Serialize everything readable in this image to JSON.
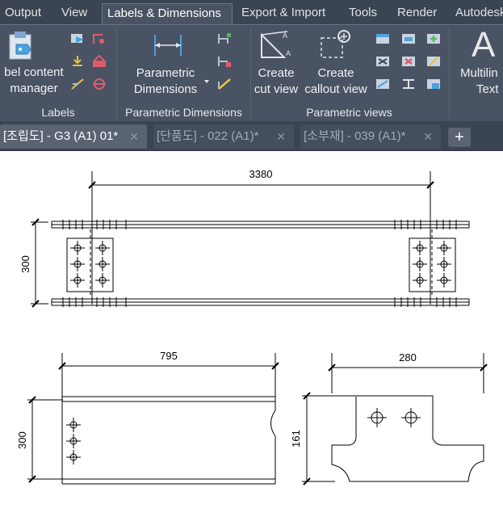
{
  "menu": {
    "tabs": [
      "Output",
      "View",
      "Labels & Dimensions",
      "Export & Import",
      "Tools",
      "Render",
      "Autodesk"
    ]
  },
  "ribbon": {
    "labels_panel": {
      "title": "Labels",
      "label_content_manager": [
        "bel content",
        "manager"
      ]
    },
    "parametric_panel": {
      "title": "Parametric Dimensions",
      "parametric_dimensions": [
        "Parametric",
        "Dimensions"
      ]
    },
    "views_panel": {
      "title": "Parametric views",
      "create_cut_view": [
        "Create",
        "cut view"
      ],
      "create_callout_view": [
        "Create",
        "callout view"
      ]
    },
    "text_panel": {
      "multiline_text": [
        "Multilin",
        "Text"
      ],
      "letter": "A"
    }
  },
  "file_tabs": [
    {
      "label": "[조립도] - G3 (A1) 01*",
      "active": true
    },
    {
      "label": "[단품도] - 022 (A1)*",
      "active": false
    },
    {
      "label": "[소부재] - 039 (A1)*",
      "active": false
    }
  ],
  "new_tab_symbol": "+",
  "close_symbol": "✕",
  "drawing": {
    "top_view": {
      "width_dim": "3380",
      "height_dim": "300"
    },
    "bottom_left_view": {
      "width_dim": "795",
      "height_dim": "300"
    },
    "bottom_right_view": {
      "width_dim": "280",
      "height_dim": "161"
    }
  },
  "colors": {
    "ribbon_bg": "#3b4453",
    "panel_bg": "#4a5363",
    "accent_blue": "#4aa3df",
    "canvas_bg": "#ffffff"
  }
}
